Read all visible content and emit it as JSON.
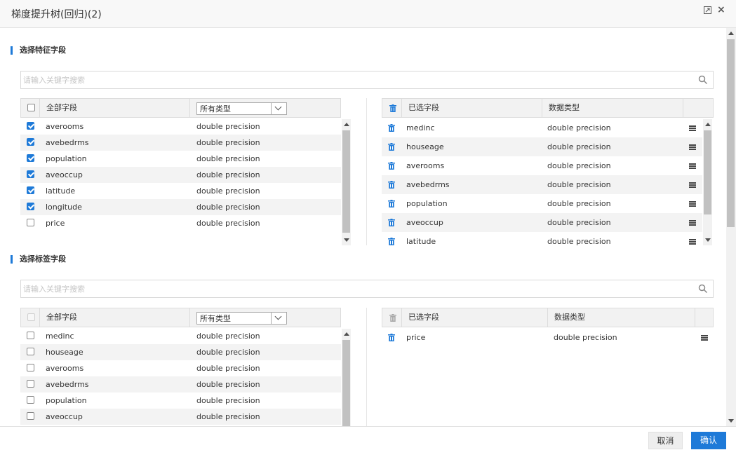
{
  "window": {
    "title": "梯度提升树(回归)(2)",
    "maximize_icon": "maximize-icon",
    "close_icon": "×"
  },
  "feature_section": {
    "title": "选择特征字段",
    "search_placeholder": "请输入关键字搜索",
    "all_fields": {
      "header_label": "全部字段",
      "type_filter": "所有类型",
      "rows": [
        {
          "name": "averooms",
          "type": "double precision",
          "checked": true
        },
        {
          "name": "avebedrms",
          "type": "double precision",
          "checked": true
        },
        {
          "name": "population",
          "type": "double precision",
          "checked": true
        },
        {
          "name": "aveoccup",
          "type": "double precision",
          "checked": true
        },
        {
          "name": "latitude",
          "type": "double precision",
          "checked": true
        },
        {
          "name": "longitude",
          "type": "double precision",
          "checked": true
        },
        {
          "name": "price",
          "type": "double precision",
          "checked": false
        }
      ]
    },
    "selected_fields": {
      "header_label": "已选字段",
      "type_header": "数据类型",
      "rows": [
        {
          "name": "medinc",
          "type": "double precision"
        },
        {
          "name": "houseage",
          "type": "double precision"
        },
        {
          "name": "averooms",
          "type": "double precision"
        },
        {
          "name": "avebedrms",
          "type": "double precision"
        },
        {
          "name": "population",
          "type": "double precision"
        },
        {
          "name": "aveoccup",
          "type": "double precision"
        },
        {
          "name": "latitude",
          "type": "double precision"
        }
      ]
    }
  },
  "label_section": {
    "title": "选择标签字段",
    "search_placeholder": "请输入关键字搜索",
    "all_fields": {
      "header_label": "全部字段",
      "type_filter": "所有类型",
      "rows": [
        {
          "name": "medinc",
          "type": "double precision",
          "checked": false
        },
        {
          "name": "houseage",
          "type": "double precision",
          "checked": false
        },
        {
          "name": "averooms",
          "type": "double precision",
          "checked": false
        },
        {
          "name": "avebedrms",
          "type": "double precision",
          "checked": false
        },
        {
          "name": "population",
          "type": "double precision",
          "checked": false
        },
        {
          "name": "aveoccup",
          "type": "double precision",
          "checked": false
        }
      ]
    },
    "selected_fields": {
      "header_label": "已选字段",
      "type_header": "数据类型",
      "rows": [
        {
          "name": "price",
          "type": "double precision"
        }
      ]
    }
  },
  "footer": {
    "cancel_label": "取消",
    "confirm_label": "确认"
  },
  "colors": {
    "accent": "#1e7ad8"
  }
}
